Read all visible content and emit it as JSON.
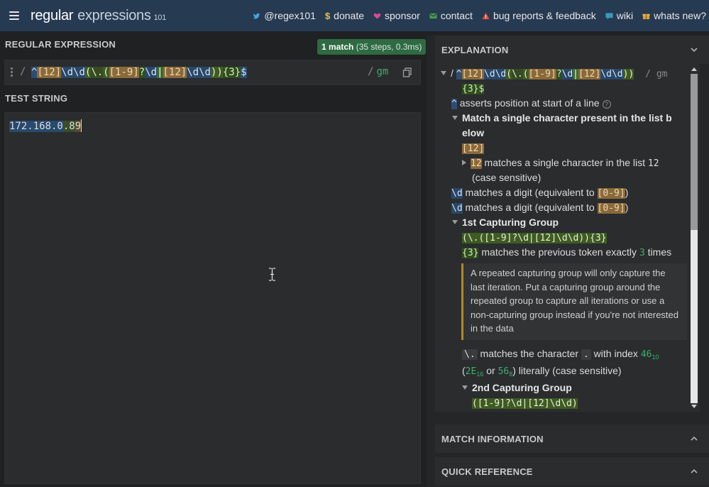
{
  "header": {
    "logo_main": "regular",
    "logo_second": "expressions",
    "logo_num": "101",
    "nav": [
      {
        "label": "@regex101",
        "icon": "twitter-icon"
      },
      {
        "label": "donate",
        "icon": "dollar-icon"
      },
      {
        "label": "sponsor",
        "icon": "heart-icon"
      },
      {
        "label": "contact",
        "icon": "envelope-icon"
      },
      {
        "label": "bug reports & feedback",
        "icon": "warning-icon"
      },
      {
        "label": "wiki",
        "icon": "chat-icon"
      },
      {
        "label": "whats new?",
        "icon": "gift-icon"
      }
    ]
  },
  "regex": {
    "section_label": "REGULAR EXPRESSION",
    "match_count": "1 match",
    "match_detail": "(35 steps, 0.3ms)",
    "delimiter_open": "/",
    "tokens": [
      "^",
      "[12]",
      "\\d",
      "\\d",
      "(",
      "\\.",
      "(",
      "[1-9]",
      "?",
      "\\d",
      "|",
      "[12]",
      "\\d",
      "\\d",
      ")",
      ")",
      "{3}",
      "$"
    ],
    "delimiter_close": "/",
    "flags": "gm"
  },
  "test_string": {
    "section_label": "TEST STRING",
    "parts": [
      "172.168.0",
      ".8",
      "9"
    ]
  },
  "explanation": {
    "title": "EXPLANATION",
    "line1_open": "/",
    "line1_flags": "/ gm",
    "line2_tok": "{3}$",
    "l_anchor_tok": "^",
    "l_anchor_text": "asserts position at start of a line",
    "l_match_text_1": "Match a single character present in the list b",
    "l_match_text_2": "elow",
    "l_class_tok": "[12]",
    "l_12_tok": "12",
    "l_12_text": "matches a single character in the list",
    "l_12_code": "12",
    "l_case": "(case sensitive)",
    "l_d_tok": "\\d",
    "l_d_text": "matches a digit (equivalent to",
    "l_d_range": "[0-9]",
    "l_d_close": ")",
    "l_group1": "1st Capturing Group",
    "l_group1_expr": "(\\.([1-9]?\\d|[12]\\d\\d)){3}",
    "l_quant_tok": "{3}",
    "l_quant_text": "matches the previous token exactly",
    "l_quant_num": "3",
    "l_quant_end": "times",
    "note": "A repeated capturing group will only capture the last iteration. Put a capturing group around the repeated group to capture all iterations or use a non-capturing group instead if you're not interested in the data",
    "l_dot_tok": "\\.",
    "l_dot_text": "matches the character",
    "l_dot_char": ".",
    "l_dot_idx": "with index",
    "l_dot_num": "46",
    "l_dot_base": "10",
    "l_hex": "2E",
    "l_hex_base": "16",
    "l_or": "or",
    "l_oct": "56",
    "l_oct_base": "8",
    "l_lit": ") literally (case sensitive)",
    "l_group2": "2nd Capturing Group",
    "l_group2_expr": "([1-9]?\\d|[12]\\d\\d)"
  },
  "match_info": {
    "title": "MATCH INFORMATION"
  },
  "quick_ref": {
    "title": "QUICK REFERENCE"
  },
  "colors": {
    "header_bg": "#263a52",
    "panel_bg": "#2a2c2e",
    "match_badge": "#2f6a42",
    "note_border": "#b08a22"
  }
}
